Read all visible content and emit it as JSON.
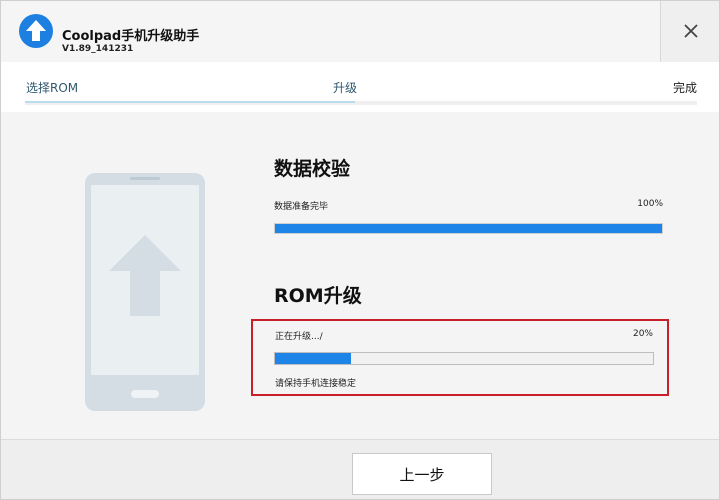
{
  "window": {
    "title": "Coolpad手机升级助手",
    "version": "V1.89_141231",
    "logo_icon": "upload-arrow-icon",
    "close_icon": "close-icon"
  },
  "steps": {
    "items": [
      {
        "label": "选择ROM"
      },
      {
        "label": "升级"
      },
      {
        "label": "完成"
      }
    ],
    "current": "升级"
  },
  "verify": {
    "title": "数据校验",
    "status": "数据准备完毕",
    "percent_label": "100%",
    "progress": 1.0
  },
  "rom_upgrade": {
    "title": "ROM升级",
    "status": "正在升级.../",
    "percent_label": "20%",
    "progress": 0.2,
    "note": "请保持手机连接稳定"
  },
  "footer": {
    "back_label": "上一步"
  },
  "colors": {
    "accent": "#1e84e8",
    "highlight_border": "#c8202a",
    "phone_illustration": "#d4dde4"
  }
}
